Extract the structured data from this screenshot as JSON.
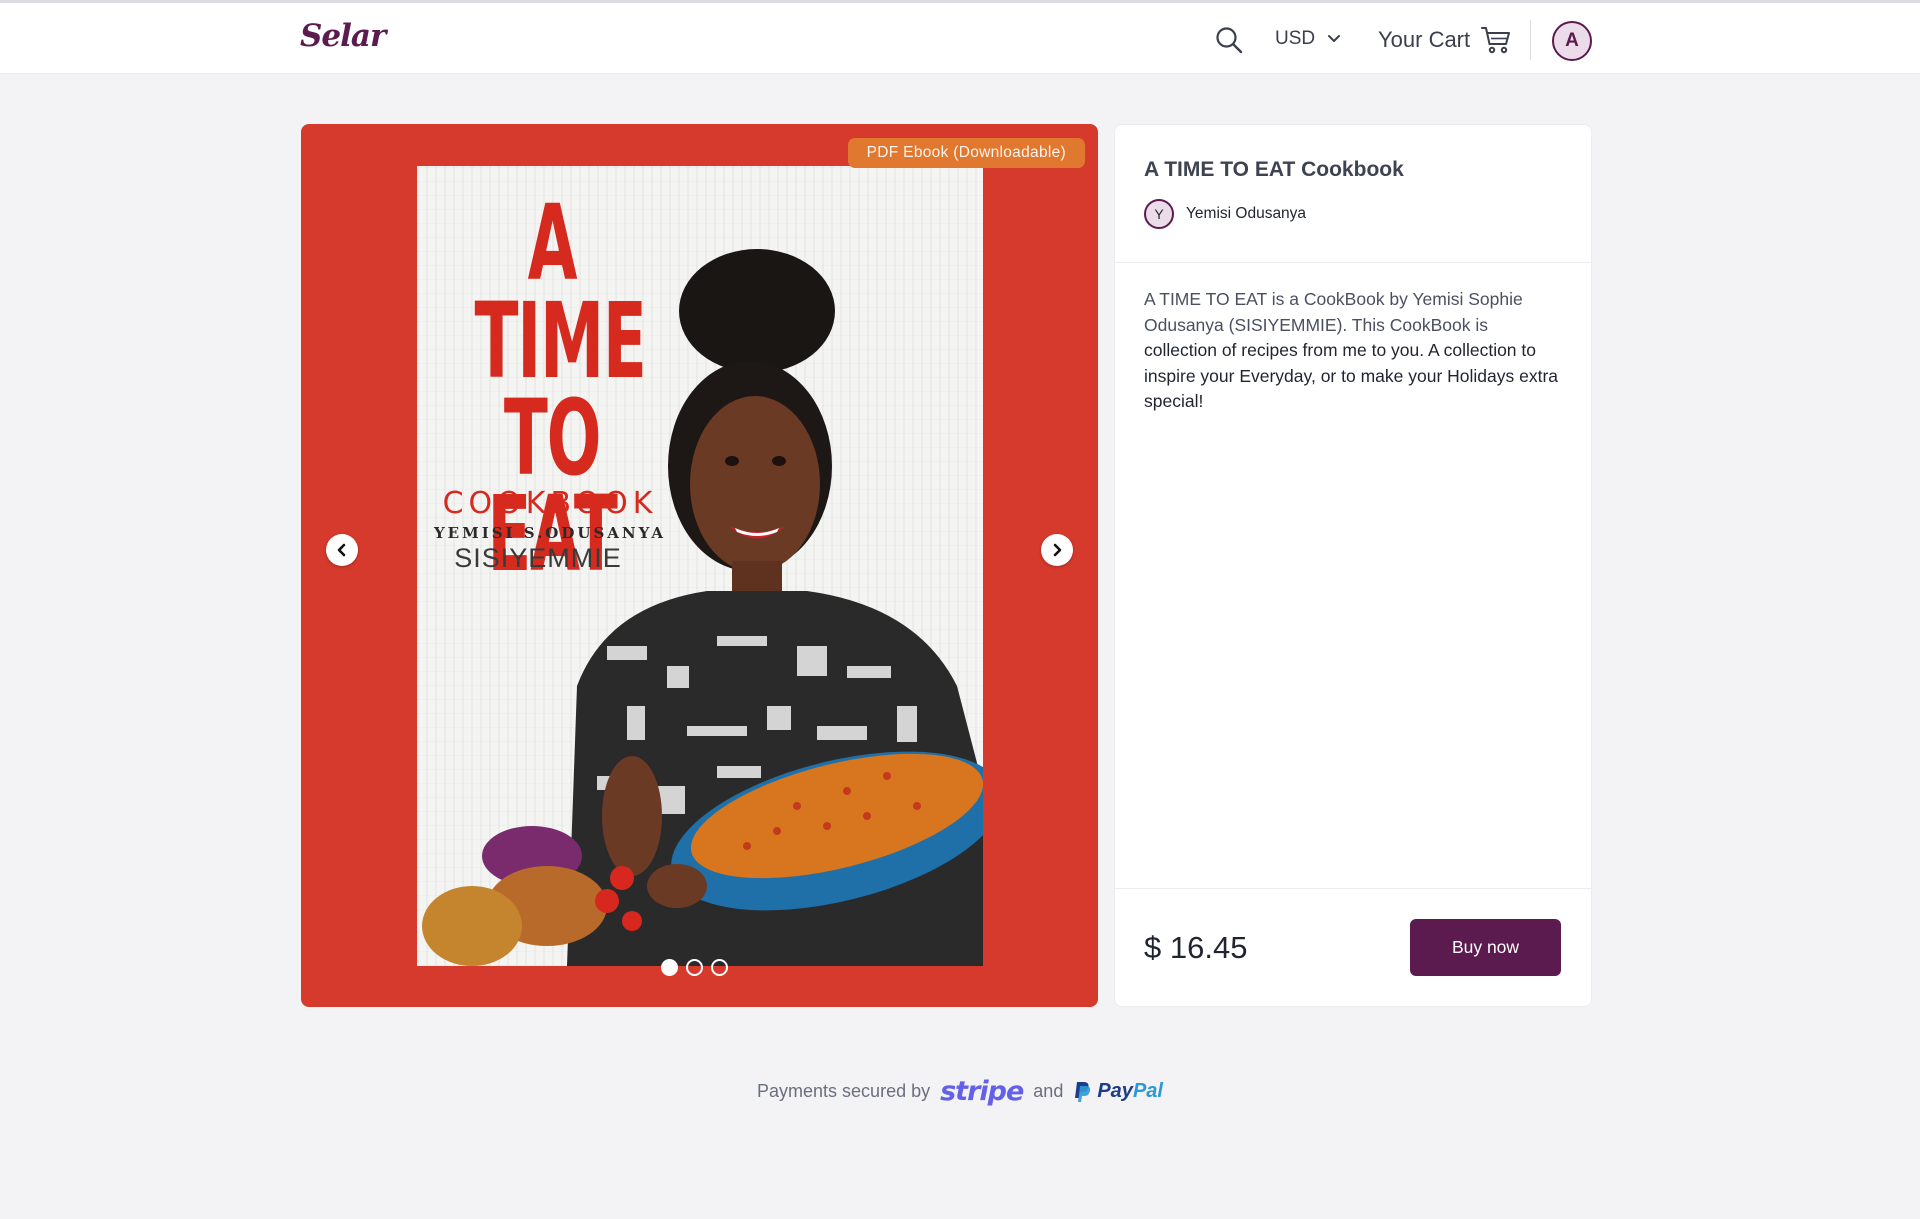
{
  "header": {
    "logo": "Selar",
    "currency": "USD",
    "cart_label": "Your Cart",
    "user_initial": "A"
  },
  "product": {
    "badge": "PDF Ebook (Downloadable)",
    "title": "A TIME TO EAT Cookbook",
    "author_initial": "Y",
    "author": "Yemisi Odusanya",
    "description_part1": "A TIME TO EAT is a CookBook by Yemisi Sophie Odusanya (SISIYEMMIE). This CookBook is",
    "description_part2": "collection of recipes from me to you. A collection to inspire your Everyday, or to make your Holidays extra special!",
    "price": "$ 16.45",
    "buy_label": "Buy now",
    "carousel_index": 1,
    "carousel_total": 3
  },
  "cover": {
    "title_line1": "A",
    "title_line2": "TIME",
    "title_line3": "TO EAT",
    "subtitle": "COOKBOOK",
    "author": "YEMISI S.ODUSANYA",
    "brand": "SISIYEMMIE"
  },
  "footer": {
    "payments_text": "Payments secured by",
    "stripe": "stripe",
    "and": "and",
    "paypal_pay": "Pay",
    "paypal_pal": "Pal"
  },
  "colors": {
    "brand": "#5b1b4f",
    "gallery_bg": "#d63a2c",
    "badge": "#e0782f",
    "stripe": "#6461e8"
  },
  "icons": [
    "search-icon",
    "chevron-down-icon",
    "cart-icon",
    "chevron-left-icon",
    "chevron-right-icon",
    "paypal-icon"
  ]
}
